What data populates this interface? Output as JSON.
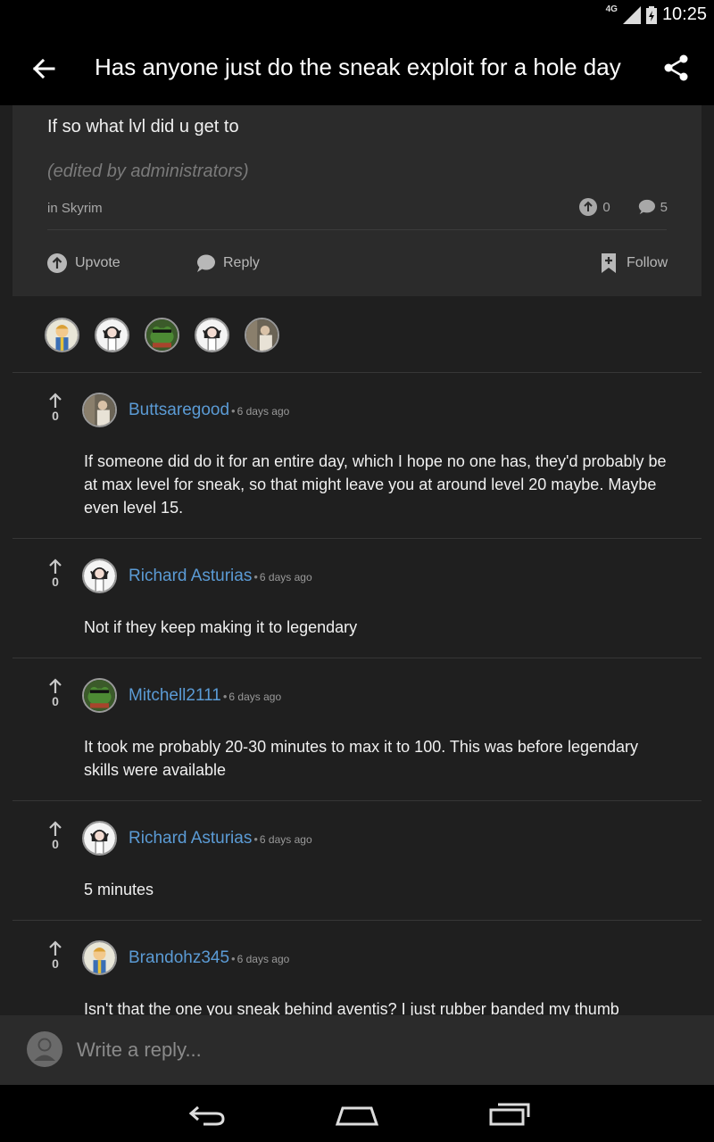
{
  "status_bar": {
    "network": "4G",
    "time": "10:25"
  },
  "app_bar": {
    "title": "Has anyone just do the sneak exploit for a hole day",
    "back_icon": "back-arrow-icon",
    "share_icon": "share-icon"
  },
  "post": {
    "body": "If so what lvl did u get to",
    "edited_note": "(edited by administrators)",
    "community": "in Skyrim",
    "upvotes": "0",
    "replies": "5",
    "actions": {
      "upvote": "Upvote",
      "reply": "Reply",
      "follow": "Follow"
    }
  },
  "participants": [
    "vault-boy",
    "anime-girl",
    "frog",
    "anime-girl",
    "character"
  ],
  "comments": [
    {
      "votes": "0",
      "username": "Buttsaregood",
      "time": "6 days ago",
      "avatar": "character",
      "text": "If someone did do it for an entire day, which I hope no one has, they'd probably be at max level for sneak, so that might leave you at around level 20 maybe. Maybe even level 15."
    },
    {
      "votes": "0",
      "username": "Richard Asturias",
      "time": "6 days ago",
      "avatar": "anime-girl",
      "text": "Not if they keep making it to legendary"
    },
    {
      "votes": "0",
      "username": "Mitchell2111",
      "time": "6 days ago",
      "avatar": "frog",
      "text": "It took me probably 20-30 minutes to max it to 100. This was before legendary skills were available"
    },
    {
      "votes": "0",
      "username": "Richard Asturias",
      "time": "6 days ago",
      "avatar": "anime-girl",
      "text": "5 minutes"
    },
    {
      "votes": "0",
      "username": "Brandohz345",
      "time": "6 days ago",
      "avatar": "vault-boy",
      "text": "Isn't that the one you sneak behind aventis? I just rubber banded my thumb"
    }
  ],
  "reply_bar": {
    "placeholder": "Write a reply..."
  },
  "colors": {
    "username": "#5b9bd5",
    "background": "#1f1f1f",
    "card": "#2b2b2b"
  }
}
